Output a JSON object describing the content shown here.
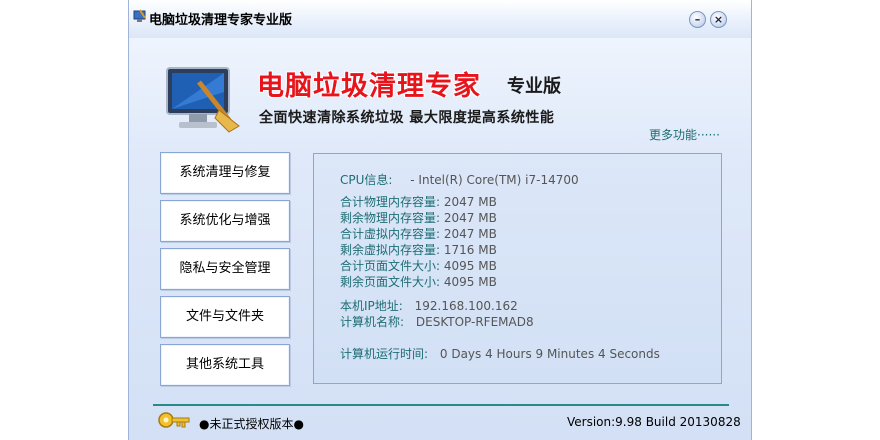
{
  "window": {
    "title": "电脑垃圾清理专家专业版",
    "minimize_glyph": "–",
    "close_glyph": "×"
  },
  "banner": {
    "title": "电脑垃圾清理专家",
    "edition": "专业版",
    "slogan": "全面快速清除系统垃圾    最大限度提高系统性能",
    "more_link": "更多功能······",
    "logo_icon": "computer-broom-icon"
  },
  "nav": [
    {
      "label": "系统清理与修复"
    },
    {
      "label": "系统优化与增强"
    },
    {
      "label": "隐私与安全管理"
    },
    {
      "label": "文件与文件夹"
    },
    {
      "label": "其他系统工具"
    }
  ],
  "info": {
    "cpu": {
      "label": "CPU信息:",
      "value": "- Intel(R) Core(TM) i7-14700"
    },
    "memory": [
      {
        "label": "合计物理内存容量:",
        "value": "2047 MB"
      },
      {
        "label": "剩余物理内存容量:",
        "value": "2047 MB"
      },
      {
        "label": "合计虚拟内存容量:",
        "value": "2047 MB"
      },
      {
        "label": "剩余虚拟内存容量:",
        "value": "1716 MB"
      },
      {
        "label": "合计页面文件大小:",
        "value": "4095 MB"
      },
      {
        "label": "剩余页面文件大小:",
        "value": "4095 MB"
      }
    ],
    "ip": {
      "label": "本机IP地址:",
      "value": "192.168.100.162"
    },
    "hostname": {
      "label": "计算机名称:",
      "value": "DESKTOP-RFEMAD8"
    },
    "uptime": {
      "label": "计算机运行时间:",
      "value": "0 Days 4 Hours 9 Minutes 4 Seconds"
    }
  },
  "footer": {
    "license": "●未正式授权版本●",
    "version": "Version:9.98 Build 20130828",
    "key_icon": "key-icon"
  },
  "colors": {
    "label": "#1e6d74",
    "value": "#555555",
    "title_red": "#e8141c",
    "accent_line": "#2a8a88"
  }
}
